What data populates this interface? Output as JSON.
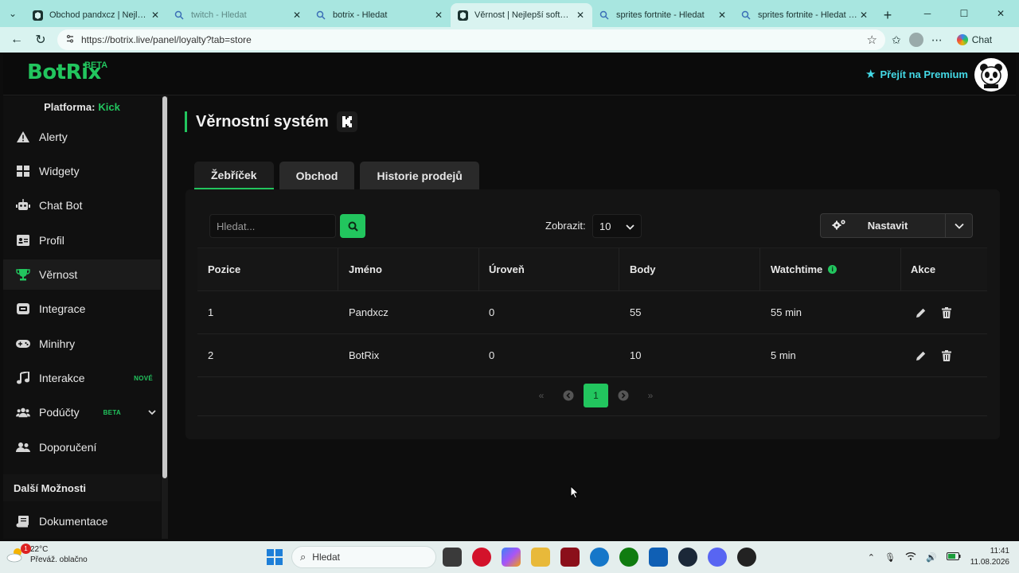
{
  "browser": {
    "tabs": [
      {
        "title": "Obchod pandxcz | Nejlepší software pro",
        "icon": "botrix-favicon",
        "active": false
      },
      {
        "title": "twitch - Hledat",
        "icon": "search-favicon",
        "active": false
      },
      {
        "title": "botrix - Hledat",
        "icon": "search-favicon",
        "active": false
      },
      {
        "title": "Věrnost | Nejlepší software pro",
        "icon": "botrix-favicon",
        "active": true
      },
      {
        "title": "sprites fortnite - Hledat",
        "icon": "search-favicon",
        "active": false
      },
      {
        "title": "sprites fortnite - Hledat Obrázky",
        "icon": "search-favicon",
        "active": false
      }
    ],
    "url": "https://botrix.live/panel/loyalty?tab=store",
    "chat_label": "Chat"
  },
  "header": {
    "logo": "BotRix",
    "logo_badge": "BETA",
    "premium_label": "Přejít na Premium",
    "premium_color": "#44d9e6"
  },
  "sidebar": {
    "platform_label": "Platforma:",
    "platform_value": "Kick",
    "items": [
      {
        "label": "Alerty",
        "icon": "warning-icon"
      },
      {
        "label": "Widgety",
        "icon": "grid-icon"
      },
      {
        "label": "Chat Bot",
        "icon": "robot-icon"
      },
      {
        "label": "Profil",
        "icon": "profile-card-icon"
      },
      {
        "label": "Věrnost",
        "icon": "trophy-icon",
        "active": true
      },
      {
        "label": "Integrace",
        "icon": "integration-icon"
      },
      {
        "label": "Minihry",
        "icon": "gamepad-icon"
      },
      {
        "label": "Interakce",
        "icon": "music-note-icon",
        "badge": "NOVÉ"
      },
      {
        "label": "Podúčty",
        "icon": "users-group-icon",
        "badge": "BETA",
        "expandable": true
      },
      {
        "label": "Doporučení",
        "icon": "user-friends-icon"
      }
    ],
    "section": "Další Možnosti",
    "extra_items": [
      {
        "label": "Dokumentace",
        "icon": "scroll-icon"
      }
    ]
  },
  "page": {
    "title": "Věrnostní systém",
    "platform_icon": "kick-logo-icon",
    "tabs": [
      {
        "label": "Žebříček",
        "active": true
      },
      {
        "label": "Obchod",
        "active": false
      },
      {
        "label": "Historie prodejů",
        "active": false
      }
    ],
    "search_placeholder": "Hledat...",
    "show_label": "Zobrazit:",
    "show_value": "10",
    "setup_label": "Nastavit",
    "accent": "#22c55e"
  },
  "table": {
    "columns": [
      "Pozice",
      "Jméno",
      "Úroveň",
      "Body",
      "Watchtime",
      "Akce"
    ],
    "rows": [
      {
        "pozice": "1",
        "jmeno": "Pandxcz",
        "uroven": "0",
        "body": "55",
        "watchtime": "55 min"
      },
      {
        "pozice": "2",
        "jmeno": "BotRix",
        "uroven": "0",
        "body": "10",
        "watchtime": "5 min"
      }
    ]
  },
  "pager": {
    "first": "«",
    "prev": "‹",
    "current": "1",
    "next": "›",
    "last": "»"
  },
  "taskbar": {
    "temperature": "22°C",
    "weather": "Převáž. oblačno",
    "weather_badge": "1",
    "search_label": "Hledat",
    "time": "11:41",
    "date": "11.08.2026"
  }
}
